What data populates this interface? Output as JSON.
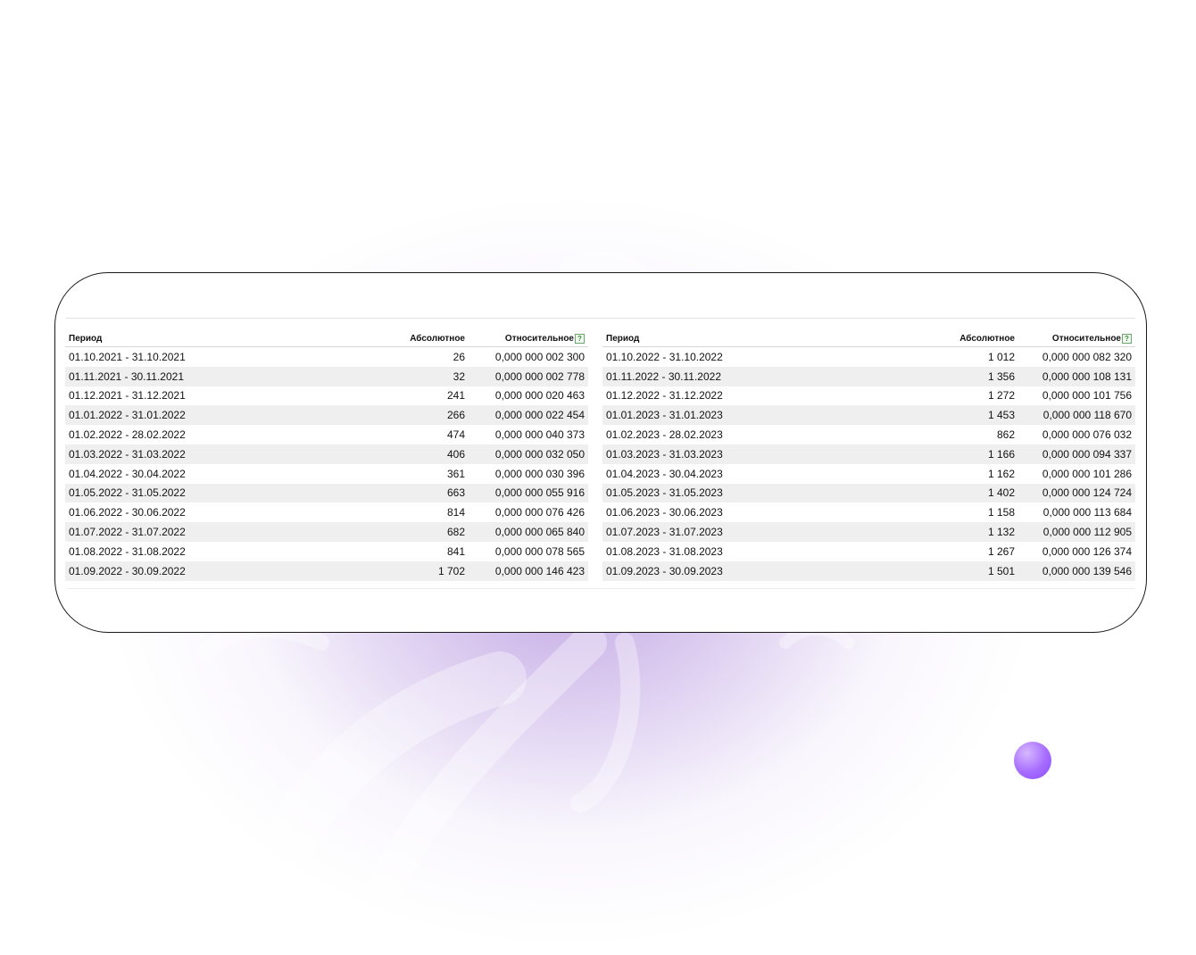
{
  "colors": {
    "accent": "#a66bff",
    "row_alt": "#efefef",
    "help_icon": "#3b8a3b"
  },
  "help_icon_glyph": "?",
  "tables": [
    {
      "headers": {
        "period": "Период",
        "absolute": "Абсолютное",
        "relative": "Относительное"
      },
      "rows": [
        {
          "period": "01.10.2021 - 31.10.2021",
          "absolute": "26",
          "relative": "0,000 000 002 300"
        },
        {
          "period": "01.11.2021 - 30.11.2021",
          "absolute": "32",
          "relative": "0,000 000 002 778"
        },
        {
          "period": "01.12.2021 - 31.12.2021",
          "absolute": "241",
          "relative": "0,000 000 020 463"
        },
        {
          "period": "01.01.2022 - 31.01.2022",
          "absolute": "266",
          "relative": "0,000 000 022 454"
        },
        {
          "period": "01.02.2022 - 28.02.2022",
          "absolute": "474",
          "relative": "0,000 000 040 373"
        },
        {
          "period": "01.03.2022 - 31.03.2022",
          "absolute": "406",
          "relative": "0,000 000 032 050"
        },
        {
          "period": "01.04.2022 - 30.04.2022",
          "absolute": "361",
          "relative": "0,000 000 030 396"
        },
        {
          "period": "01.05.2022 - 31.05.2022",
          "absolute": "663",
          "relative": "0,000 000 055 916"
        },
        {
          "period": "01.06.2022 - 30.06.2022",
          "absolute": "814",
          "relative": "0,000 000 076 426"
        },
        {
          "period": "01.07.2022 - 31.07.2022",
          "absolute": "682",
          "relative": "0,000 000 065 840"
        },
        {
          "period": "01.08.2022 - 31.08.2022",
          "absolute": "841",
          "relative": "0,000 000 078 565"
        },
        {
          "period": "01.09.2022 - 30.09.2022",
          "absolute": "1 702",
          "relative": "0,000 000 146 423"
        }
      ]
    },
    {
      "headers": {
        "period": "Период",
        "absolute": "Абсолютное",
        "relative": "Относительное"
      },
      "rows": [
        {
          "period": "01.10.2022 - 31.10.2022",
          "absolute": "1 012",
          "relative": "0,000 000 082 320"
        },
        {
          "period": "01.11.2022 - 30.11.2022",
          "absolute": "1 356",
          "relative": "0,000 000 108 131"
        },
        {
          "period": "01.12.2022 - 31.12.2022",
          "absolute": "1 272",
          "relative": "0,000 000 101 756"
        },
        {
          "period": "01.01.2023 - 31.01.2023",
          "absolute": "1 453",
          "relative": "0,000 000 118 670"
        },
        {
          "period": "01.02.2023 - 28.02.2023",
          "absolute": "862",
          "relative": "0,000 000 076 032"
        },
        {
          "period": "01.03.2023 - 31.03.2023",
          "absolute": "1 166",
          "relative": "0,000 000 094 337"
        },
        {
          "period": "01.04.2023 - 30.04.2023",
          "absolute": "1 162",
          "relative": "0,000 000 101 286"
        },
        {
          "period": "01.05.2023 - 31.05.2023",
          "absolute": "1 402",
          "relative": "0,000 000 124 724"
        },
        {
          "period": "01.06.2023 - 30.06.2023",
          "absolute": "1 158",
          "relative": "0,000 000 113 684"
        },
        {
          "period": "01.07.2023 - 31.07.2023",
          "absolute": "1 132",
          "relative": "0,000 000 112 905"
        },
        {
          "period": "01.08.2023 - 31.08.2023",
          "absolute": "1 267",
          "relative": "0,000 000 126 374"
        },
        {
          "period": "01.09.2023 - 30.09.2023",
          "absolute": "1 501",
          "relative": "0,000 000 139 546"
        }
      ]
    }
  ]
}
